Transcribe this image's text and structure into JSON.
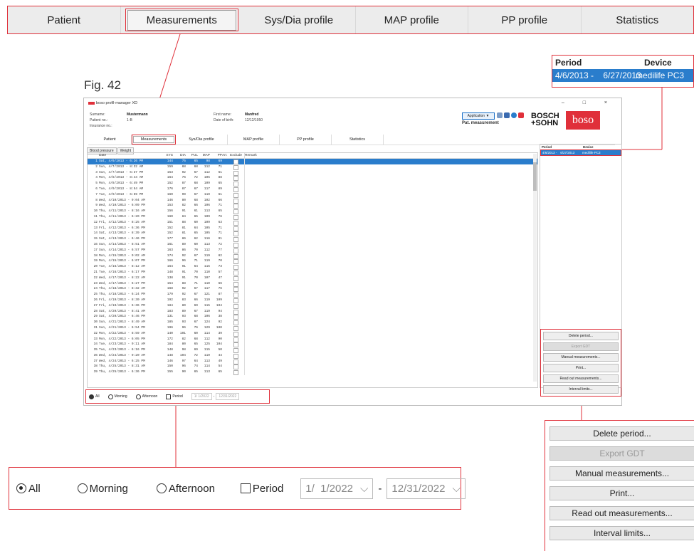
{
  "zoom_tabs": [
    "Patient",
    "Measurements",
    "Sys/Dia profile",
    "MAP profile",
    "PP profile",
    "Statistics"
  ],
  "zoom_period": {
    "period_header": "Period",
    "device_header": "Device",
    "row_period": "4/6/2013 -    6/27/2013",
    "row_device": "medilife PC3"
  },
  "figure_label": "Fig. 42",
  "window": {
    "title": "boso profil-manager XD",
    "controls": "– □ ×",
    "surname_label": "Surname:",
    "surname": "Mustermann",
    "patient_no_label": "Patient no.:",
    "patient_no": "1-B",
    "insurance_label": "Insurance no.:",
    "first_name_label": "First name:",
    "first_name": "Manfred",
    "dob_label": "Date of birth:",
    "dob": "12/12/1950",
    "application_btn": "Application ▼",
    "pat_measurement": "Pat. measurement",
    "brand_line1": "BOSCH",
    "brand_line2": "+SOHN",
    "boso": "boso",
    "tabs": [
      "Patient",
      "Measurements",
      "Sys/Dia profile",
      "MAP profile",
      "PP profile",
      "Statistics"
    ],
    "subtabs": [
      "Blood pressure",
      "Weight"
    ],
    "headers": [
      "",
      "Date",
      "SYS",
      "DIA",
      "PUL",
      "MAP",
      "PP",
      "Arr.",
      "Exclude",
      "Remark"
    ],
    "rows": [
      [
        "1",
        "Sat, 4/6/2013 - 6:26 PM",
        "144",
        "75",
        "65",
        "98",
        "69"
      ],
      [
        "2",
        "Sun, 4/7/2013 - 8:32 AM",
        "159",
        "88",
        "68",
        "112",
        "71"
      ],
      [
        "3",
        "Sun, 4/7/2013 - 6:37 PM",
        "153",
        "92",
        "67",
        "112",
        "61"
      ],
      [
        "4",
        "Mon, 4/8/2013 - 8:44 AM",
        "164",
        "76",
        "72",
        "105",
        "88"
      ],
      [
        "5",
        "Mon, 4/8/2013 - 6:49 PM",
        "152",
        "87",
        "68",
        "109",
        "65"
      ],
      [
        "6",
        "Tue, 4/9/2013 - 8:54 AM",
        "176",
        "87",
        "67",
        "117",
        "89"
      ],
      [
        "7",
        "Tue, 4/9/2013 - 6:59 PM",
        "160",
        "99",
        "67",
        "119",
        "61"
      ],
      [
        "8",
        "Wed, 4/10/2013 - 9:04 AM",
        "146",
        "80",
        "68",
        "102",
        "66"
      ],
      [
        "9",
        "Wed, 4/10/2013 - 6:09 PM",
        "153",
        "82",
        "66",
        "106",
        "71"
      ],
      [
        "10",
        "Thu, 4/11/2013 - 8:16 AM",
        "156",
        "91",
        "61",
        "113",
        "65"
      ],
      [
        "11",
        "Thu, 4/11/2013 - 6:20 PM",
        "160",
        "84",
        "65",
        "109",
        "76"
      ],
      [
        "12",
        "Fri, 4/12/2013 - 8:25 AM",
        "151",
        "88",
        "60",
        "109",
        "63"
      ],
      [
        "13",
        "Fri, 4/12/2013 - 6:36 PM",
        "152",
        "81",
        "64",
        "105",
        "71"
      ],
      [
        "14",
        "Sat, 4/13/2013 - 8:39 AM",
        "152",
        "81",
        "65",
        "105",
        "71"
      ],
      [
        "15",
        "Sat, 4/13/2013 - 6:46 PM",
        "177",
        "86",
        "62",
        "116",
        "91"
      ],
      [
        "16",
        "Sun, 4/14/2013 - 8:51 AM",
        "161",
        "89",
        "60",
        "113",
        "72"
      ],
      [
        "17",
        "Sun, 4/14/2013 - 6:57 PM",
        "163",
        "86",
        "70",
        "112",
        "77"
      ],
      [
        "18",
        "Mon, 4/15/2013 - 9:02 AM",
        "174",
        "92",
        "67",
        "119",
        "82"
      ],
      [
        "19",
        "Mon, 4/15/2013 - 6:07 PM",
        "166",
        "96",
        "71",
        "119",
        "70"
      ],
      [
        "20",
        "Tue, 4/16/2013 - 8:12 AM",
        "164",
        "91",
        "64",
        "115",
        "73"
      ],
      [
        "21",
        "Tue, 4/16/2013 - 6:17 PM",
        "148",
        "91",
        "70",
        "110",
        "57"
      ],
      [
        "22",
        "Wed, 4/17/2013 - 8:22 AM",
        "138",
        "91",
        "70",
        "107",
        "47"
      ],
      [
        "23",
        "Wed, 4/17/2013 - 6:27 PM",
        "154",
        "88",
        "71",
        "110",
        "66"
      ],
      [
        "24",
        "Thu, 4/18/2013 - 8:32 AM",
        "168",
        "92",
        "67",
        "117",
        "76"
      ],
      [
        "25",
        "Thu, 4/18/2013 - 6:24 PM",
        "179",
        "92",
        "67",
        "121",
        "87"
      ],
      [
        "26",
        "Fri, 4/19/2013 - 8:30 AM",
        "192",
        "83",
        "66",
        "119",
        "109"
      ],
      [
        "27",
        "Fri, 4/19/2013 - 6:36 PM",
        "184",
        "80",
        "69",
        "115",
        "104"
      ],
      [
        "28",
        "Sat, 4/20/2013 - 8:41 AM",
        "183",
        "89",
        "67",
        "119",
        "94"
      ],
      [
        "29",
        "Sat, 4/20/2013 - 6:46 PM",
        "131",
        "93",
        "68",
        "106",
        "38"
      ],
      [
        "30",
        "Sun, 4/21/2013 - 8:49 AM",
        "185",
        "93",
        "67",
        "124",
        "92"
      ],
      [
        "31",
        "Sun, 4/21/2013 - 6:54 PM",
        "196",
        "96",
        "76",
        "129",
        "100"
      ],
      [
        "32",
        "Mon, 4/22/2013 - 8:59 AM",
        "140",
        "101",
        "60",
        "114",
        "39"
      ],
      [
        "33",
        "Mon, 4/22/2013 - 6:05 PM",
        "172",
        "82",
        "68",
        "112",
        "90"
      ],
      [
        "34",
        "Tue, 4/23/2013 - 9:11 AM",
        "184",
        "80",
        "65",
        "125",
        "104"
      ],
      [
        "35",
        "Tue, 4/23/2013 - 6:16 PM",
        "148",
        "98",
        "69",
        "115",
        "50"
      ],
      [
        "36",
        "Wed, 4/24/2013 - 9:20 AM",
        "148",
        "104",
        "72",
        "119",
        "44"
      ],
      [
        "37",
        "Wed, 4/24/2013 - 6:25 PM",
        "146",
        "97",
        "64",
        "113",
        "49"
      ],
      [
        "38",
        "Thu, 4/25/2013 - 8:31 AM",
        "150",
        "96",
        "74",
        "114",
        "54"
      ],
      [
        "39",
        "Thu, 4/25/2013 - 6:36 PM",
        "155",
        "90",
        "65",
        "113",
        "65"
      ]
    ],
    "period_header": "Period",
    "device_header": "Device",
    "period_row": "4/6/2013 -    6/27/2013",
    "device_row": "medilife PC3",
    "buttons": [
      "Delete period...",
      "Export GDT",
      "Manual measurements...",
      "Print...",
      "Read out measurements...",
      "Interval limits..."
    ],
    "filter": {
      "all": "All",
      "morning": "Morning",
      "afternoon": "Afternoon",
      "period": "Period",
      "from": "1/  1/2022",
      "to": "12/31/2022",
      "sep": "-"
    }
  },
  "zoom_filter": {
    "all": "All",
    "morning": "Morning",
    "afternoon": "Afternoon",
    "period": "Period",
    "from": "1/  1/2022",
    "to": "12/31/2022",
    "sep": "-"
  },
  "zoom_buttons": [
    "Delete period...",
    "Export GDT",
    "Manual measurements...",
    "Print...",
    "Read out measurements...",
    "Interval limits..."
  ],
  "colors": {
    "accent": "#e0303a",
    "selection": "#2a7dcc"
  }
}
